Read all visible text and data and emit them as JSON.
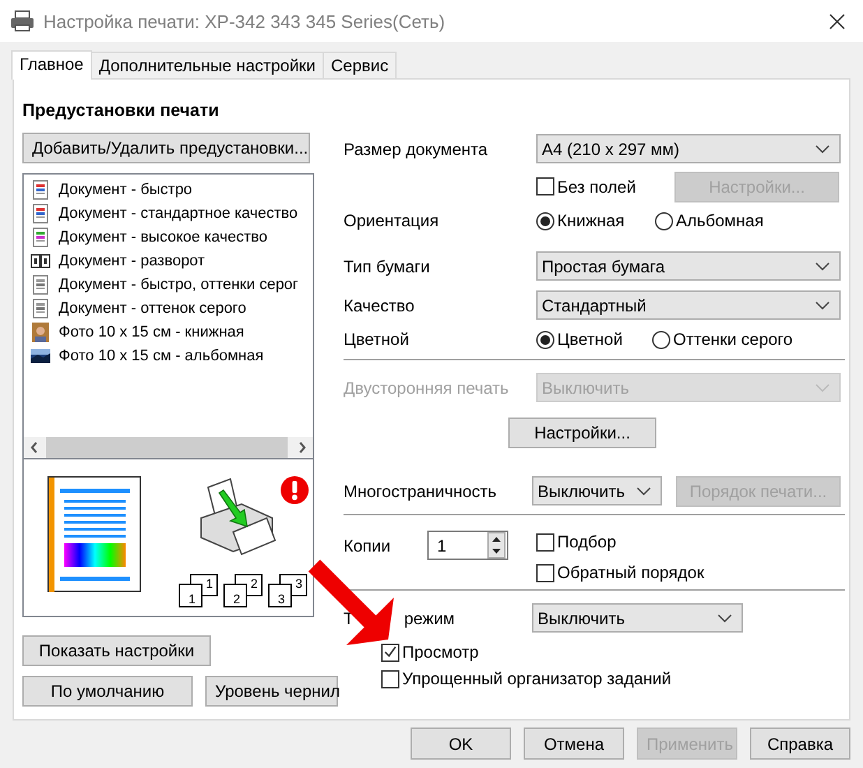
{
  "window": {
    "title": "Настройка печати: XP-342 343 345 Series(Сеть)"
  },
  "tabs": [
    {
      "label": "Главное",
      "selected": true
    },
    {
      "label": "Дополнительные настройки",
      "selected": false
    },
    {
      "label": "Сервис",
      "selected": false
    }
  ],
  "presets": {
    "heading": "Предустановки печати",
    "add_button": "Добавить/Удалить предустановки...",
    "items": [
      {
        "kind": "doc",
        "label": "Документ - быстро"
      },
      {
        "kind": "doc",
        "label": "Документ - стандартное качество"
      },
      {
        "kind": "doc-hq",
        "label": "Документ - высокое качество"
      },
      {
        "kind": "booklet",
        "label": "Документ - разворот"
      },
      {
        "kind": "doc-gray",
        "label": "Документ - быстро, оттенки серог"
      },
      {
        "kind": "doc-gray",
        "label": "Документ - оттенок серого"
      },
      {
        "kind": "photo-portrait",
        "label": "Фото 10 x 15 см - книжная"
      },
      {
        "kind": "photo-landscape",
        "label": "Фото 10 x 15 см - альбомная"
      }
    ],
    "collate_pages": [
      {
        "front": "1",
        "back": "1"
      },
      {
        "front": "2",
        "back": "2"
      },
      {
        "front": "3",
        "back": "3"
      }
    ],
    "show_settings_button": "Показать настройки",
    "defaults_button": "По умолчанию",
    "ink_button": "Уровень чернил"
  },
  "settings": {
    "document_size": {
      "label": "Размер документа",
      "value": "A4 (210 x 297 мм)"
    },
    "borderless": {
      "label": "Без полей",
      "checked": false
    },
    "borderless_settings": {
      "label": "Настройки...",
      "disabled": true
    },
    "orientation": {
      "label": "Ориентация",
      "options": [
        {
          "label": "Книжная",
          "selected": true
        },
        {
          "label": "Альбомная",
          "selected": false
        }
      ]
    },
    "paper_type": {
      "label": "Тип бумаги",
      "value": "Простая бумага"
    },
    "quality": {
      "label": "Качество",
      "value": "Стандартный"
    },
    "color": {
      "label": "Цветной",
      "options": [
        {
          "label": "Цветной",
          "selected": true
        },
        {
          "label": "Оттенки серого",
          "selected": false
        }
      ]
    },
    "duplex": {
      "label": "Двусторонняя печать",
      "value": "Выключить",
      "disabled": true
    },
    "duplex_settings": {
      "label": "Настройки...",
      "disabled": false
    },
    "multipage": {
      "label": "Многостраничность",
      "value": "Выключить"
    },
    "print_order": {
      "label": "Порядок печати...",
      "disabled": true
    },
    "copies": {
      "label": "Копии",
      "value": "1"
    },
    "collate": {
      "label": "Подбор",
      "checked": false
    },
    "reverse_order": {
      "label": "Обратный порядок",
      "checked": false
    },
    "quiet_mode": {
      "label_start": "Т",
      "label_end": "режим",
      "value": "Выключить"
    },
    "preview": {
      "label": "Просмотр",
      "checked": true
    },
    "job_arranger": {
      "label": "Упрощенный организатор заданий",
      "checked": false
    }
  },
  "buttons": [
    {
      "label": "OK",
      "disabled": false
    },
    {
      "label": "Отмена",
      "disabled": false
    },
    {
      "label": "Применить",
      "disabled": true
    },
    {
      "label": "Справка",
      "disabled": false
    }
  ]
}
